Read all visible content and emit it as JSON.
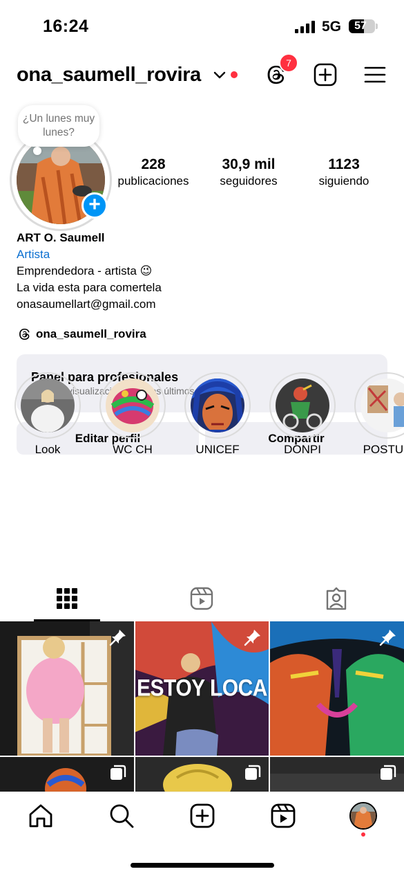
{
  "status_bar": {
    "time": "16:24",
    "network": "5G",
    "battery": "57",
    "battery_level": 0.57
  },
  "header": {
    "username": "ona_saumell_rovira",
    "notification_count": "7",
    "icons": [
      "chevron-down-icon",
      "threads-icon",
      "add-square-icon",
      "menu-icon"
    ]
  },
  "profile": {
    "note": "¿Un lunes muy lunes?",
    "stats": {
      "posts": {
        "value": "228",
        "label": "publicaciones"
      },
      "followers": {
        "value": "30,9 mil",
        "label": "seguidores"
      },
      "following": {
        "value": "1123",
        "label": "siguiendo"
      }
    },
    "bio": {
      "name": "ART O. Saumell",
      "category": "Artista",
      "line1": "Emprendedora - artista 😉",
      "line2": "La vida esta para comertela",
      "email": "onasaumellart@gmail.com"
    },
    "threads_handle": "ona_saumell_rovira"
  },
  "pro_panel": {
    "title": "Panel para profesionales",
    "subtitle": "71,8 mil visualizaciones en los últimos 30 días."
  },
  "buttons": {
    "edit": "Editar perfil",
    "share": "Compartir"
  },
  "highlights": [
    {
      "label": "Look"
    },
    {
      "label": "WC CH"
    },
    {
      "label": "UNICEF"
    },
    {
      "label": "DONPI"
    },
    {
      "label": "POSTUR"
    }
  ],
  "tabs": [
    "grid-icon",
    "reels-icon",
    "tagged-icon"
  ],
  "posts": [
    {
      "caption": "",
      "icon": "pin-icon"
    },
    {
      "caption": "ESTOY LOCA",
      "icon": "pin-icon"
    },
    {
      "caption": "",
      "icon": "pin-icon"
    },
    {
      "caption": "",
      "icon": "carousel-icon"
    },
    {
      "caption": "",
      "icon": "carousel-icon"
    },
    {
      "caption": "",
      "icon": "carousel-icon"
    }
  ],
  "bottom_nav": [
    "home-icon",
    "search-icon",
    "create-icon",
    "reels-icon",
    "profile-avatar"
  ]
}
